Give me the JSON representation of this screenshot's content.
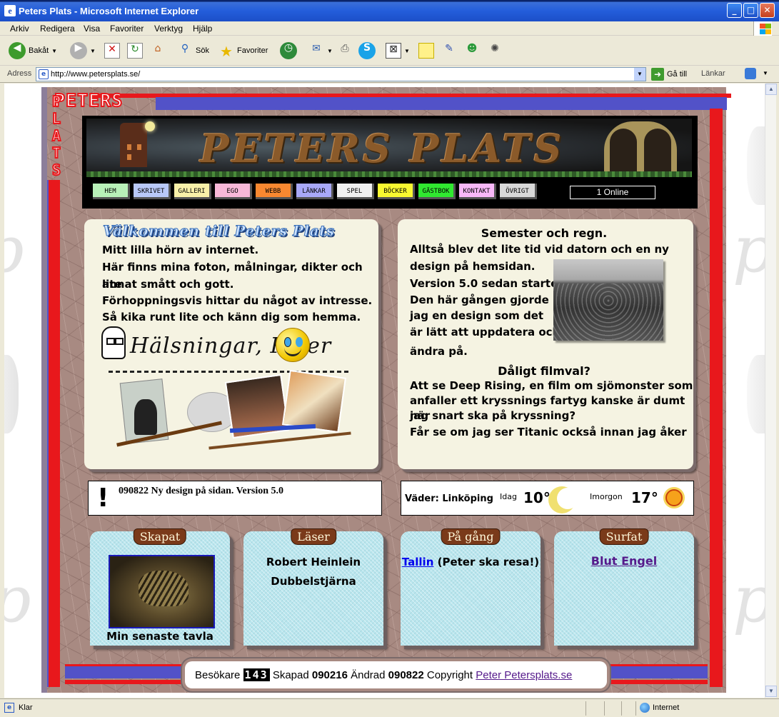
{
  "window": {
    "title": "Peters Plats - Microsoft Internet Explorer",
    "controls": {
      "minimize": "_",
      "maximize": "□",
      "close": "✕"
    }
  },
  "menu": [
    "Arkiv",
    "Redigera",
    "Visa",
    "Favoriter",
    "Verktyg",
    "Hjälp"
  ],
  "toolbar": {
    "back_label": "Bakåt",
    "search_label": "Sök",
    "favorites_label": "Favoriter"
  },
  "address": {
    "label": "Adress",
    "url": "http://www.petersplats.se/",
    "go_label": "Gå till",
    "links_label": "Länkar"
  },
  "site": {
    "logo_top": "PETERS",
    "logo_side": "PLATS",
    "banner_title": "PETERS PLATS",
    "nav": [
      {
        "label": "HEM",
        "color": "#b8f0b8"
      },
      {
        "label": "SKRIVET",
        "color": "#b8c8f8"
      },
      {
        "label": "GALLERI",
        "color": "#f8f0a8"
      },
      {
        "label": "EGO",
        "color": "#f8b8d8"
      },
      {
        "label": "WEBB",
        "color": "#f88830"
      },
      {
        "label": "LÄNKAR",
        "color": "#a8a8f8"
      },
      {
        "label": "SPEL",
        "color": "#f0f0f0"
      },
      {
        "label": "BÖCKER",
        "color": "#f8f830"
      },
      {
        "label": "GÄSTBOK",
        "color": "#30e830"
      },
      {
        "label": "KONTAKT",
        "color": "#f8b8f8"
      },
      {
        "label": "ÖVRIGT",
        "color": "#d8d8d8"
      }
    ],
    "online": "1 Online",
    "welcome": {
      "title": "Välkommen till Peters Plats",
      "lines": [
        "Mitt lilla hörn av internet.",
        "Här finns mina foton, målningar, dikter och lite",
        "annat smått och gott.",
        "Förhoppningsvis hittar du något av intresse.",
        "Så kika runt lite och känn dig som hemma."
      ],
      "signature": "Hälsningar, Peter"
    },
    "news": {
      "title": "Semester och regn.",
      "lines": [
        "Alltså blev det lite tid vid datorn och en ny",
        "design på hemsidan.",
        "Version 5.0 sedan starten.",
        "Den här gången gjorde",
        "jag en design som det",
        "är lätt att uppdatera och",
        "ändra på."
      ],
      "title2": "Dåligt filmval?",
      "lines2": [
        "Att se Deep Rising, en film om sjömonster som",
        "anfaller ett kryssnings fartyg kanske är dumt när",
        "jag snart ska på kryssning?",
        "Får se om jag ser Titanic också innan jag åker"
      ]
    },
    "update_note": "090822 Ny design på sidan. Version 5.0",
    "weather": {
      "label": "Väder: Linköping",
      "today_label": "Idag",
      "today_temp": "10°",
      "tomorrow_label": "Imorgon",
      "tomorrow_temp": "17°"
    },
    "cards": {
      "created": {
        "tag": "Skapat",
        "caption": "Min senaste tavla"
      },
      "reading": {
        "tag": "Läser",
        "line1": "Robert Heinlein",
        "line2": "Dubbelstjärna"
      },
      "upcoming": {
        "tag": "På gång",
        "link": "Tallin",
        "rest": " (Peter ska resa!)"
      },
      "surfed": {
        "tag": "Surfat",
        "link": "Blut Engel"
      }
    },
    "footer": {
      "visitors_label": "Besökare",
      "visitors": "143",
      "created_label": "Skapad",
      "created": "090216",
      "changed_label": "Ändrad",
      "changed": "090822",
      "copyright_label": "Copyright",
      "copyright_link": "Peter Petersplats.se"
    }
  },
  "status": {
    "text": "Klar",
    "zone": "Internet"
  }
}
